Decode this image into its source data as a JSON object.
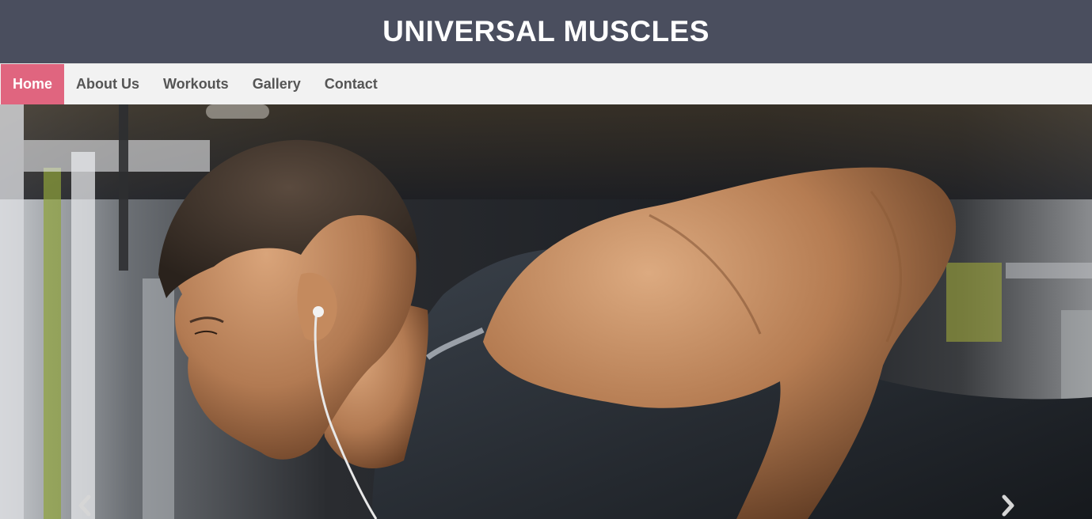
{
  "header": {
    "title": "UNIVERSAL MUSCLES"
  },
  "nav": {
    "items": [
      {
        "label": "Home",
        "active": true
      },
      {
        "label": "About Us",
        "active": false
      },
      {
        "label": "Workouts",
        "active": false
      },
      {
        "label": "Gallery",
        "active": false
      },
      {
        "label": "Contact",
        "active": false
      }
    ]
  },
  "hero": {
    "image": "fitness-athlete-photo",
    "prev_icon": "chevron-left-icon",
    "next_icon": "chevron-right-icon"
  },
  "colors": {
    "header_bg": "#4a4e5e",
    "nav_bg": "#f2f2f2",
    "nav_active": "#e0657f",
    "nav_text": "#555555"
  }
}
